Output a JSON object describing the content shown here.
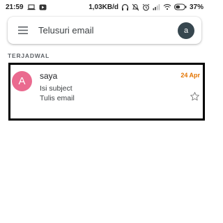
{
  "status_bar": {
    "time": "21:59",
    "net_speed": "1,03KB/d",
    "battery": "37%",
    "icons": [
      "laptop-icon",
      "youtube-icon",
      "headphones-icon",
      "mute-icon",
      "alarm-icon",
      "signal-icon",
      "wifi-icon",
      "battery-icon"
    ]
  },
  "search": {
    "placeholder": "Telusuri email",
    "menu_icon": "hamburger-menu-icon",
    "account_initial": "a"
  },
  "section": {
    "label": "TERJADWAL"
  },
  "emails": [
    {
      "avatar_letter": "A",
      "avatar_color": "#ea6a8f",
      "sender": "saya",
      "date": "24 Apr",
      "date_color": "#e37400",
      "subject": "Isi subject",
      "snippet": "Tulis email",
      "starred": false
    }
  ]
}
